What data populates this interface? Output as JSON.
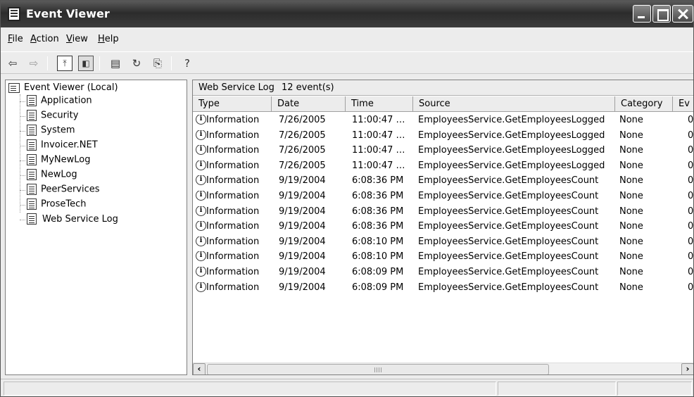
{
  "window": {
    "title": "Event Viewer"
  },
  "menu": [
    {
      "underline": "F",
      "rest": "ile"
    },
    {
      "underline": "A",
      "rest": "ction"
    },
    {
      "underline": "V",
      "rest": "iew"
    },
    {
      "underline": "H",
      "rest": "elp"
    }
  ],
  "toolbar": {
    "icons": [
      "back-arrow-icon",
      "forward-arrow-icon",
      "up-folder-icon",
      "show-hide-tree-icon",
      "properties-icon",
      "refresh-icon",
      "export-list-icon",
      "help-icon"
    ]
  },
  "tree": {
    "root": "Event Viewer (Local)",
    "items": [
      "Application",
      "Security",
      "System",
      "Invoicer.NET",
      "MyNewLog",
      "NewLog",
      "PeerServices",
      "ProseTech",
      "Web Service Log"
    ],
    "selected": "Web Service Log"
  },
  "list": {
    "title": "Web Service Log",
    "count": "12 event(s)",
    "columns": [
      "Type",
      "Date",
      "Time",
      "Source",
      "Category",
      "Ev"
    ],
    "rows": [
      [
        "Information",
        "7/26/2005",
        "11:00:47 …",
        "EmployeesService.GetEmployeesLogged",
        "None",
        "0"
      ],
      [
        "Information",
        "7/26/2005",
        "11:00:47 …",
        "EmployeesService.GetEmployeesLogged",
        "None",
        "0"
      ],
      [
        "Information",
        "7/26/2005",
        "11:00:47 …",
        "EmployeesService.GetEmployeesLogged",
        "None",
        "0"
      ],
      [
        "Information",
        "7/26/2005",
        "11:00:47 …",
        "EmployeesService.GetEmployeesLogged",
        "None",
        "0"
      ],
      [
        "Information",
        "9/19/2004",
        "6:08:36 PM",
        "EmployeesService.GetEmployeesCount",
        "None",
        "0"
      ],
      [
        "Information",
        "9/19/2004",
        "6:08:36 PM",
        "EmployeesService.GetEmployeesCount",
        "None",
        "0"
      ],
      [
        "Information",
        "9/19/2004",
        "6:08:36 PM",
        "EmployeesService.GetEmployeesCount",
        "None",
        "0"
      ],
      [
        "Information",
        "9/19/2004",
        "6:08:36 PM",
        "EmployeesService.GetEmployeesCount",
        "None",
        "0"
      ],
      [
        "Information",
        "9/19/2004",
        "6:08:10 PM",
        "EmployeesService.GetEmployeesCount",
        "None",
        "0"
      ],
      [
        "Information",
        "9/19/2004",
        "6:08:10 PM",
        "EmployeesService.GetEmployeesCount",
        "None",
        "0"
      ],
      [
        "Information",
        "9/19/2004",
        "6:08:09 PM",
        "EmployeesService.GetEmployeesCount",
        "None",
        "0"
      ],
      [
        "Information",
        "9/19/2004",
        "6:08:09 PM",
        "EmployeesService.GetEmployeesCount",
        "None",
        "0"
      ]
    ]
  }
}
